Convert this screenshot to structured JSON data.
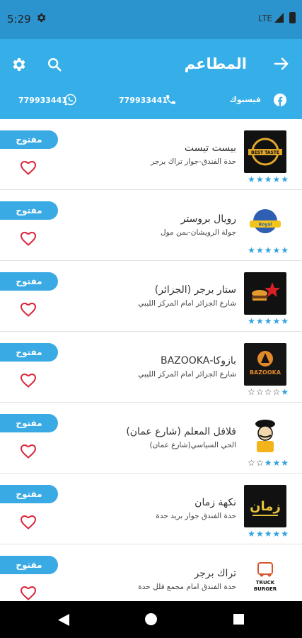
{
  "status_bar": {
    "time": "5:29",
    "network": "LTE"
  },
  "header": {
    "title": "المطاعم",
    "facebook_label": "فيسبوك",
    "phone_number": "779933441",
    "whatsapp_number": "779933441"
  },
  "restaurants": [
    {
      "name": "بيست تيست",
      "address": "حدة الفندق-جوار تراك برجر",
      "status": "مفتوح",
      "rating": 5,
      "logo": "BEST TASTE"
    },
    {
      "name": "رويال بروستر",
      "address": "جولة الرويشان-بمن مول",
      "status": "مفتوح",
      "rating": 5,
      "logo": "Royal Broaster"
    },
    {
      "name": "ستار برجر (الجزائر)",
      "address": "شارع الجزائر امام المركز الليبي",
      "status": "مفتوح",
      "rating": 5,
      "logo": "STAR BURGER"
    },
    {
      "name": "بازوكا-BAZOOKA",
      "address": "شارع الجزائر امام المركز الليبي",
      "status": "مفتوح",
      "rating": 1,
      "logo": "BAZOOKA"
    },
    {
      "name": "فلافل المعلم (شارع عمان)",
      "address": "الحي السياسي(شارع عمان)",
      "status": "مفتوح",
      "rating": 3,
      "logo": "Falafel"
    },
    {
      "name": "نكهة زمان",
      "address": "حدة الفندق جوار بريد حدة",
      "status": "مفتوح",
      "rating": 5,
      "logo": "زمان"
    },
    {
      "name": "تراك برجر",
      "address": "حدة الفندق امام مجمع فلل حدة",
      "status": "مفتوح",
      "rating": 0,
      "logo": "TRUCK BURGER"
    }
  ],
  "colors": {
    "primary": "#36aee8",
    "status_bar": "#2b94cf",
    "badge": "#3aaae4",
    "heart": "#d9253b",
    "star": "#2ea3df"
  }
}
